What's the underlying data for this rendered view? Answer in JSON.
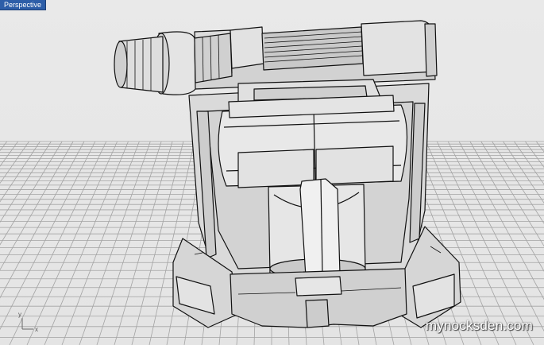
{
  "viewport": {
    "label": "Perspective",
    "axis_x": "x",
    "axis_y": "y"
  },
  "watermark": "mynocksden.com",
  "colors": {
    "label_bg": "#2d5ea8",
    "grid_line": "#9a9a9a",
    "model_fill": "#d9d9d9",
    "model_edge": "#111111"
  }
}
